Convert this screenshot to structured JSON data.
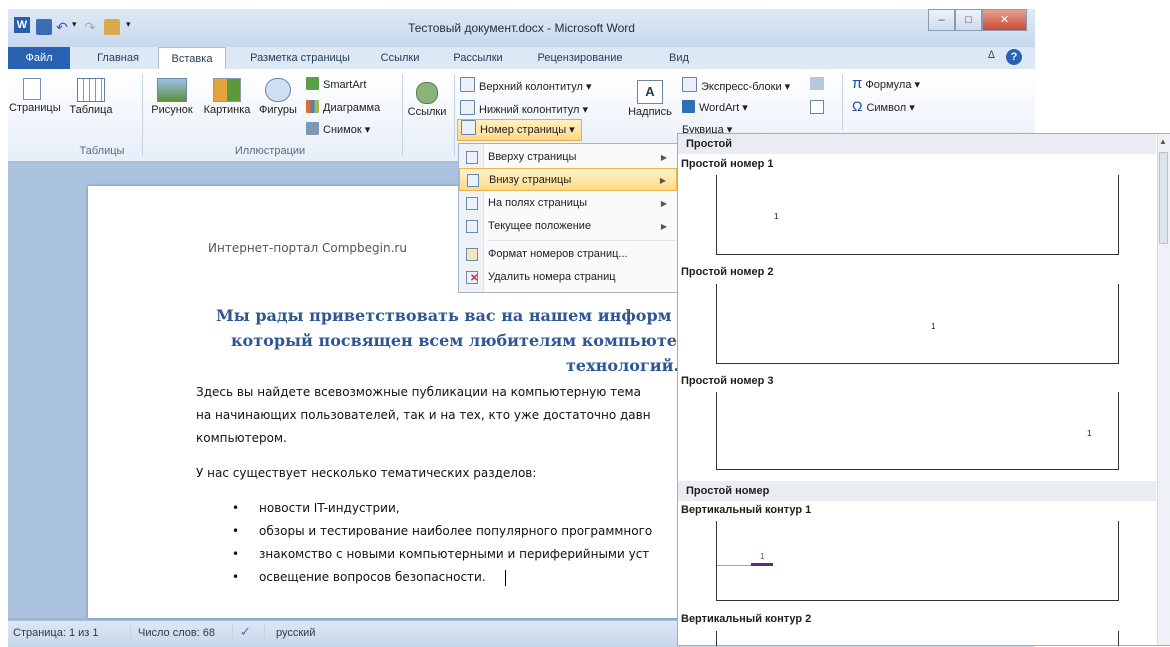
{
  "window": {
    "title": "Тестовый документ.docx - Microsoft Word",
    "minimize": "–",
    "maximize": "□",
    "close": "✕"
  },
  "quick_access": {
    "undo_arrow": "▾",
    "customize": "▾"
  },
  "tabs": [
    "Файл",
    "Главная",
    "Вставка",
    "Разметка страницы",
    "Ссылки",
    "Рассылки",
    "Рецензирование",
    "Вид"
  ],
  "ribbon": {
    "pages": "Страницы",
    "table": "Таблица",
    "picture": "Рисунок",
    "clipart": "Картинка",
    "shapes": "Фигуры",
    "smartart": "SmartArt",
    "chart": "Диаграмма",
    "screenshot": "Снимок ▾",
    "links": "Ссылки",
    "header": "Верхний колонтитул ▾",
    "footer": "Нижний колонтитул ▾",
    "page_number": "Номер страницы ▾",
    "textbox": "Надпись",
    "quickparts": "Экспресс-блоки ▾",
    "wordart": "WordArt ▾",
    "dropcap": "Буквица ▾",
    "equation": "Формула ▾",
    "symbol": "Символ ▾",
    "group_tables": "Таблицы",
    "group_illustrations": "Иллюстрации"
  },
  "document": {
    "header_text": "Интернет-портал Compbegin.ru",
    "heading_lines": [
      "Мы рады приветствовать вас на нашем информ",
      "который посвящен всем любителям компьюте",
      "технологий."
    ],
    "para1": [
      "Здесь вы найдете всевозможные публикации на компьютерную тема",
      "на начинающих пользователей, так и на тех, кто уже достаточно давн",
      "компьютером."
    ],
    "para2": "У нас существует несколько тематических разделов:",
    "bullets": [
      "новости IT-индустрии,",
      "обзоры и тестирование наиболее популярного программного",
      "знакомство с новыми компьютерными и периферийными уст",
      "освещение вопросов безопасности."
    ]
  },
  "status_bar": {
    "page": "Страница: 1 из 1",
    "words": "Число слов: 68",
    "language": "русский"
  },
  "page_number_menu": [
    {
      "label": "Вверху страницы",
      "submenu": true
    },
    {
      "label": "Внизу страницы",
      "submenu": true,
      "highlighted": true
    },
    {
      "label": "На полях страницы",
      "submenu": true
    },
    {
      "label": "Текущее положение",
      "submenu": true
    },
    {
      "label": "Формат номеров страниц...",
      "submenu": false
    },
    {
      "label": "Удалить номера страниц",
      "submenu": false
    }
  ],
  "gallery": {
    "section1": "Простой",
    "items": [
      {
        "title": "Простой номер 1",
        "number": "1"
      },
      {
        "title": "Простой номер 2",
        "number": "1"
      },
      {
        "title": "Простой номер 3",
        "number": "1"
      }
    ],
    "section2": "Простой номер",
    "vertical": [
      {
        "title": "Вертикальный контур 1",
        "number": "1"
      },
      {
        "title": "Вертикальный контур 2"
      }
    ]
  },
  "colors": {
    "accent": "#2a62b3",
    "heading": "#2f5796",
    "highlight": "#ffd98a"
  }
}
